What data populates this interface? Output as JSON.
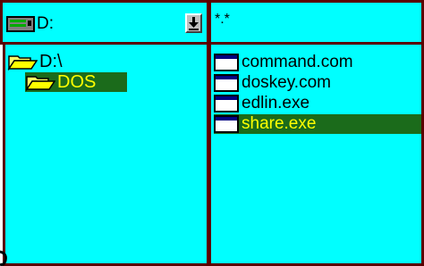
{
  "drive_selector": {
    "value": "D:",
    "icon": "drive-icon",
    "dropdown_icon": "down-arrow-icon"
  },
  "filter": {
    "value": "*.*"
  },
  "directory_tree": {
    "items": [
      {
        "label": "D:\\",
        "icon": "open-folder-icon",
        "selected": false
      },
      {
        "label": "DOS",
        "icon": "open-folder-icon",
        "selected": true
      }
    ]
  },
  "file_list": {
    "items": [
      {
        "label": "command.com",
        "icon": "file-icon",
        "selected": false
      },
      {
        "label": "doskey.com",
        "icon": "file-icon",
        "selected": false
      },
      {
        "label": "edlin.exe",
        "icon": "file-icon",
        "selected": false
      },
      {
        "label": "share.exe",
        "icon": "file-icon",
        "selected": true
      }
    ]
  },
  "colors": {
    "pane_bg": "#00ffff",
    "border": "#5a0000",
    "selection_bg": "#1b6b1b",
    "selection_text": "#ffff00"
  }
}
